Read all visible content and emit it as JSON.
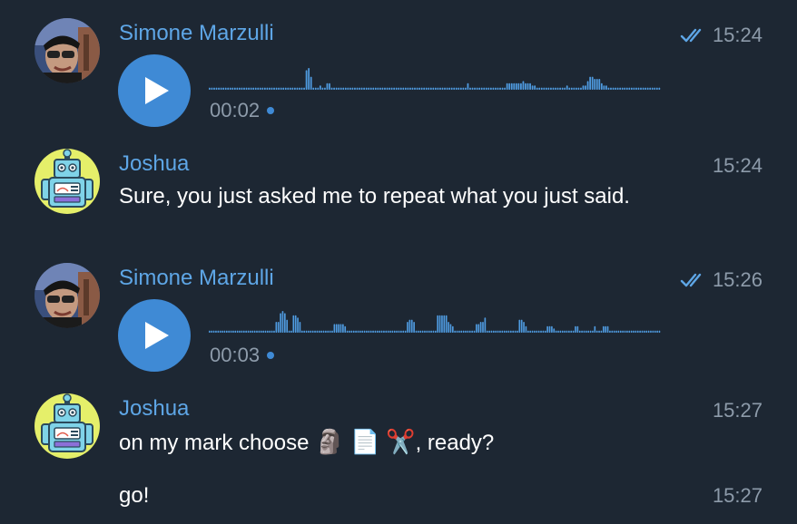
{
  "messages": [
    {
      "sender": "Simone Marzulli",
      "time": "15:24",
      "read": true,
      "type": "voice",
      "duration": "00:02",
      "waveform": [
        1,
        1,
        1,
        1,
        1,
        1,
        1,
        1,
        1,
        1,
        1,
        1,
        1,
        1,
        1,
        1,
        1,
        1,
        1,
        1,
        1,
        1,
        1,
        1,
        1,
        1,
        1,
        1,
        1,
        1,
        1,
        1,
        1,
        1,
        1,
        1,
        1,
        1,
        1,
        1,
        1,
        1,
        9,
        10,
        6,
        1,
        1,
        1,
        2,
        1,
        1,
        3,
        3,
        1,
        1,
        1,
        1,
        1,
        1,
        1,
        1,
        1,
        1,
        1,
        1,
        1,
        1,
        1,
        1,
        1,
        1,
        1,
        1,
        1,
        1,
        1,
        1,
        1,
        1,
        1,
        1,
        1,
        1,
        1,
        1,
        1,
        1,
        1,
        1,
        1,
        1,
        1,
        1,
        1,
        1,
        1,
        1,
        1,
        1,
        1,
        1,
        1,
        1,
        1,
        1,
        1,
        1,
        1,
        1,
        1,
        1,
        1,
        3,
        1,
        1,
        1,
        1,
        1,
        1,
        1,
        1,
        1,
        1,
        1,
        1,
        1,
        1,
        1,
        1,
        3,
        3,
        3,
        3,
        3,
        3,
        3,
        4,
        3,
        3,
        3,
        2,
        2,
        1,
        1,
        1,
        1,
        1,
        1,
        1,
        1,
        1,
        1,
        1,
        1,
        1,
        2,
        1,
        1,
        1,
        1,
        1,
        1,
        2,
        2,
        4,
        6,
        6,
        5,
        5,
        5,
        3,
        2,
        2,
        1,
        1,
        1,
        1,
        1,
        1,
        1,
        1,
        1,
        1,
        1,
        1,
        1,
        1,
        1,
        1,
        1,
        1,
        1,
        1,
        1,
        1,
        1
      ]
    },
    {
      "sender": "Joshua",
      "time": "15:24",
      "type": "text",
      "text": "Sure, you just asked me to repeat what you just said."
    },
    {
      "sender": "Simone Marzulli",
      "time": "15:26",
      "read": true,
      "type": "voice",
      "duration": "00:03",
      "waveform": [
        1,
        1,
        1,
        1,
        1,
        1,
        1,
        1,
        1,
        1,
        1,
        1,
        1,
        1,
        1,
        1,
        1,
        1,
        1,
        1,
        1,
        1,
        1,
        1,
        1,
        1,
        1,
        1,
        1,
        1,
        1,
        5,
        5,
        9,
        10,
        9,
        6,
        1,
        1,
        8,
        8,
        7,
        5,
        1,
        1,
        1,
        1,
        1,
        1,
        1,
        1,
        1,
        1,
        1,
        1,
        1,
        1,
        1,
        4,
        4,
        4,
        4,
        4,
        3,
        1,
        1,
        1,
        1,
        1,
        1,
        1,
        1,
        1,
        1,
        1,
        1,
        1,
        1,
        1,
        1,
        1,
        1,
        1,
        1,
        1,
        1,
        1,
        1,
        1,
        1,
        1,
        1,
        5,
        6,
        6,
        5,
        1,
        1,
        1,
        1,
        1,
        1,
        1,
        1,
        1,
        1,
        8,
        8,
        8,
        8,
        8,
        5,
        4,
        3,
        1,
        1,
        1,
        1,
        1,
        1,
        1,
        1,
        1,
        1,
        4,
        4,
        5,
        5,
        7,
        1,
        1,
        1,
        1,
        1,
        1,
        1,
        1,
        1,
        1,
        1,
        1,
        1,
        1,
        1,
        6,
        6,
        5,
        3,
        1,
        1,
        1,
        1,
        1,
        1,
        1,
        1,
        1,
        3,
        3,
        3,
        2,
        1,
        1,
        1,
        1,
        1,
        1,
        1,
        1,
        1,
        3,
        3,
        1,
        1,
        1,
        1,
        1,
        1,
        1,
        3,
        1,
        1,
        1,
        3,
        3,
        3,
        1,
        1,
        1,
        1,
        1,
        1,
        1,
        1,
        1,
        1,
        1,
        1,
        1,
        1,
        1,
        1,
        1,
        1,
        1,
        1,
        1,
        1,
        1,
        1
      ]
    },
    {
      "sender": "Joshua",
      "time": "15:27",
      "type": "text",
      "text_before": "on my mark choose ",
      "emoji_1": "🗿",
      "emoji_2": "📄",
      "emoji_3": "✂️",
      "text_after": ", ready?"
    },
    {
      "time": "15:27",
      "type": "text",
      "text": "go!"
    }
  ],
  "colors": {
    "background": "#1d2733",
    "accent": "#5ea6e6",
    "play_button": "#3f8ad5",
    "waveform": "#4f9be0",
    "muted": "#8d9baa"
  },
  "icons": [
    "double-check-icon",
    "play-icon",
    "unplayed-dot-icon",
    "avatar-photo",
    "avatar-robot"
  ]
}
